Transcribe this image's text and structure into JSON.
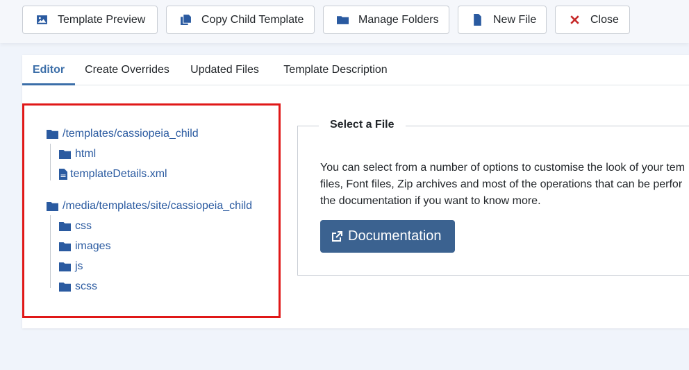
{
  "toolbar": {
    "buttons": [
      {
        "label": "Template Preview",
        "icon": "image-icon"
      },
      {
        "label": "Copy Child Template",
        "icon": "copy-icon"
      },
      {
        "label": "Manage Folders",
        "icon": "folder-icon"
      },
      {
        "label": "New File",
        "icon": "file-icon"
      },
      {
        "label": "Close",
        "icon": "close-icon"
      }
    ]
  },
  "tabs": [
    {
      "label": "Editor",
      "active": true
    },
    {
      "label": "Create Overrides",
      "active": false
    },
    {
      "label": "Updated Files",
      "active": false
    },
    {
      "label": "Template Description",
      "active": false
    }
  ],
  "tree": {
    "root1": {
      "label": "/templates/cassiopeia_child",
      "children": [
        "html"
      ],
      "file": "templateDetails.xml"
    },
    "root2": {
      "label": "/media/templates/site/cassiopeia_child",
      "children": [
        "css",
        "images",
        "js",
        "scss"
      ]
    }
  },
  "select_file": {
    "legend": "Select a File",
    "description_lines": [
      "You can select from a number of options to customise the look of your tem",
      "files, Font files, Zip archives and most of the operations that can be perfor",
      "the documentation if you want to know more."
    ],
    "button_label": "Documentation"
  },
  "colors": {
    "accent": "#2a5aa0",
    "tab_active": "#3b6ea8",
    "doc_button": "#3b6290",
    "highlight_border": "#e01818",
    "close_icon": "#c52828"
  }
}
